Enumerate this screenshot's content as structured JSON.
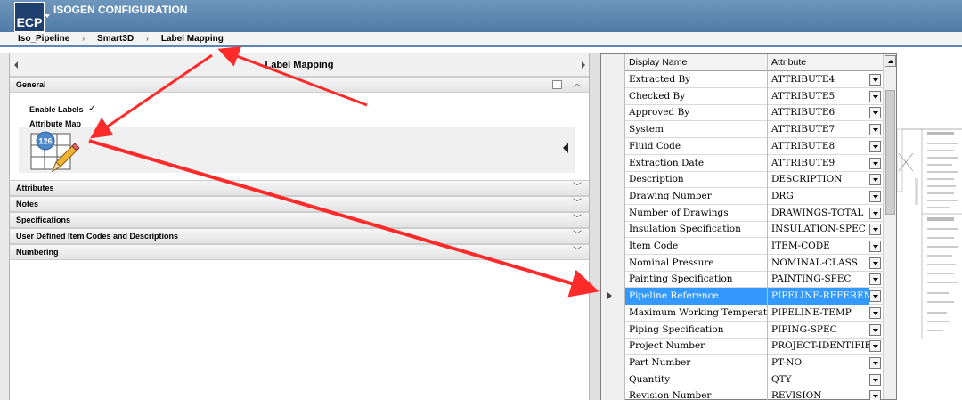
{
  "app": {
    "logo": "ECP",
    "title": "ISOGEN CONFIGURATION"
  },
  "breadcrumb": [
    "Iso_Pipeline",
    "Smart3D",
    "Label Mapping"
  ],
  "panel": {
    "title": "Label Mapping"
  },
  "general": {
    "title": "General",
    "enable_labels_label": "Enable Labels",
    "enable_labels_checked": true,
    "attribute_map_label": "Attribute Map",
    "attribute_map_badge": "126"
  },
  "sections": [
    "Attributes",
    "Notes",
    "Specifications",
    "User Defined Item Codes and Descriptions",
    "Numbering"
  ],
  "grid": {
    "columns": [
      "Display Name",
      "Attribute"
    ],
    "rows": [
      [
        "Extracted By",
        "ATTRIBUTE4"
      ],
      [
        "Checked By",
        "ATTRIBUTE5"
      ],
      [
        "Approved By",
        "ATTRIBUTE6"
      ],
      [
        "System",
        "ATTRIBUTE7"
      ],
      [
        "Fluid Code",
        "ATTRIBUTE8"
      ],
      [
        "Extraction Date",
        "ATTRIBUTE9"
      ],
      [
        "Description",
        "DESCRIPTION"
      ],
      [
        "Drawing Number",
        "DRG"
      ],
      [
        "Number of Drawings",
        "DRAWINGS-TOTAL"
      ],
      [
        "Insulation Specification",
        "INSULATION-SPEC"
      ],
      [
        "Item Code",
        "ITEM-CODE"
      ],
      [
        "Nominal Pressure",
        "NOMINAL-CLASS"
      ],
      [
        "Painting Specification",
        "PAINTING-SPEC"
      ],
      [
        "Pipeline Reference",
        "PIPELINE-REFERENCE"
      ],
      [
        "Maximum Working Temperature",
        "PIPELINE-TEMP"
      ],
      [
        "Piping Specification",
        "PIPING-SPEC"
      ],
      [
        "Project Number",
        "PROJECT-IDENTIFIER"
      ],
      [
        "Part Number",
        "PT-NO"
      ],
      [
        "Quantity",
        "QTY"
      ],
      [
        "Revision Number",
        "REVISION"
      ]
    ],
    "selected_row": 13
  },
  "colors": {
    "titlebar": "#5a87b3",
    "selection": "#3399ff",
    "annotation_arrow": "#ff2a2a"
  }
}
